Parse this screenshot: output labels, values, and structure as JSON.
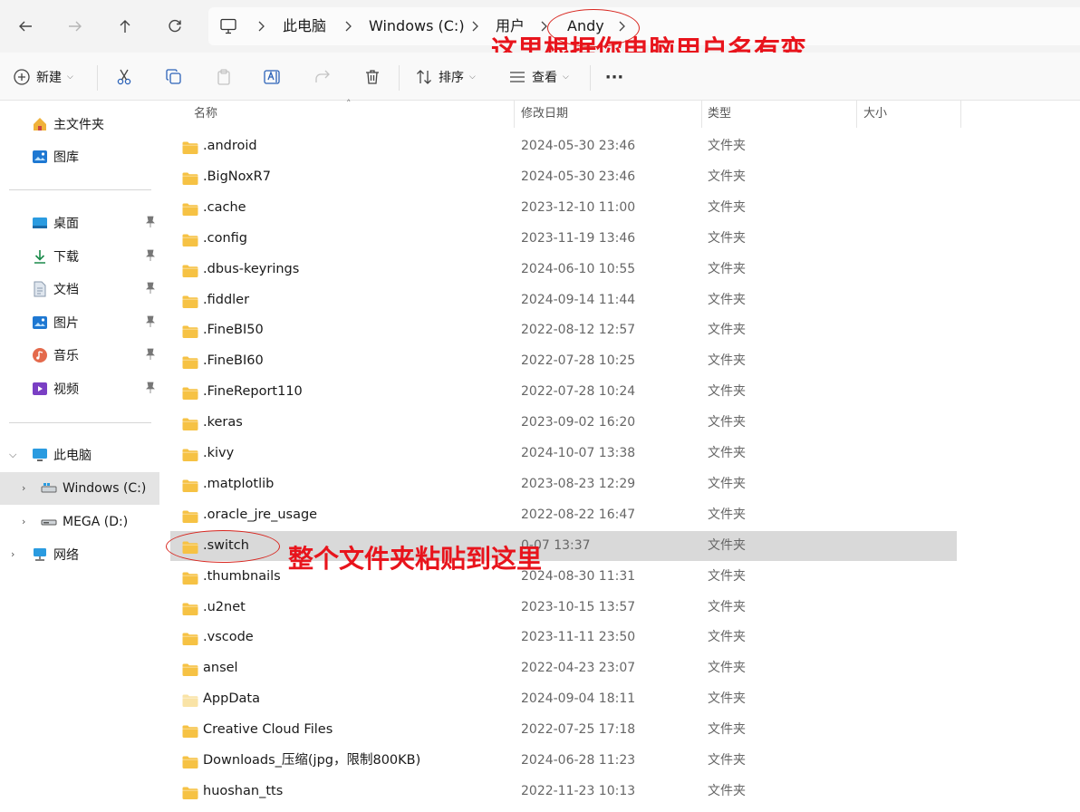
{
  "breadcrumb": {
    "items": [
      "此电脑",
      "Windows (C:)",
      "用户",
      "Andy"
    ]
  },
  "annotations": {
    "top": "这里根据你电脑用户名有变",
    "row": "整个文件夹粘贴到这里"
  },
  "toolbar": {
    "new_label": "新建",
    "sort_label": "排序",
    "view_label": "查看",
    "more_label": "···"
  },
  "sidebar": {
    "top_items": [
      {
        "label": "主文件夹",
        "icon": "home-icon"
      },
      {
        "label": "图库",
        "icon": "gallery-icon"
      }
    ],
    "quick_items": [
      {
        "label": "桌面",
        "icon": "desktop-icon"
      },
      {
        "label": "下载",
        "icon": "download-icon"
      },
      {
        "label": "文档",
        "icon": "document-icon"
      },
      {
        "label": "图片",
        "icon": "pictures-icon"
      },
      {
        "label": "音乐",
        "icon": "music-icon"
      },
      {
        "label": "视频",
        "icon": "video-icon"
      }
    ],
    "tree_items": [
      {
        "label": "此电脑",
        "icon": "pc-icon"
      },
      {
        "label": "Windows (C:)",
        "icon": "drive-icon"
      },
      {
        "label": "MEGA (D:)",
        "icon": "drive-icon"
      },
      {
        "label": "网络",
        "icon": "network-icon"
      }
    ]
  },
  "columns": {
    "name": "名称",
    "date": "修改日期",
    "type": "类型",
    "size": "大小"
  },
  "files": [
    {
      "name": ".android",
      "date": "2024-05-30 23:46",
      "type": "文件夹"
    },
    {
      "name": ".BigNoxR7",
      "date": "2024-05-30 23:46",
      "type": "文件夹"
    },
    {
      "name": ".cache",
      "date": "2023-12-10 11:00",
      "type": "文件夹"
    },
    {
      "name": ".config",
      "date": "2023-11-19 13:46",
      "type": "文件夹"
    },
    {
      "name": ".dbus-keyrings",
      "date": "2024-06-10 10:55",
      "type": "文件夹"
    },
    {
      "name": ".fiddler",
      "date": "2024-09-14 11:44",
      "type": "文件夹"
    },
    {
      "name": ".FineBI50",
      "date": "2022-08-12 12:57",
      "type": "文件夹"
    },
    {
      "name": ".FineBI60",
      "date": "2022-07-28 10:25",
      "type": "文件夹"
    },
    {
      "name": ".FineReport110",
      "date": "2022-07-28 10:24",
      "type": "文件夹"
    },
    {
      "name": ".keras",
      "date": "2023-09-02 16:20",
      "type": "文件夹"
    },
    {
      "name": ".kivy",
      "date": "2024-10-07 13:38",
      "type": "文件夹"
    },
    {
      "name": ".matplotlib",
      "date": "2023-08-23 12:29",
      "type": "文件夹"
    },
    {
      "name": ".oracle_jre_usage",
      "date": "2022-08-22 16:47",
      "type": "文件夹"
    },
    {
      "name": ".switch",
      "date": "0-07 13:37",
      "type": "文件夹",
      "selected": true
    },
    {
      "name": ".thumbnails",
      "date": "2024-08-30 11:31",
      "type": "文件夹"
    },
    {
      "name": ".u2net",
      "date": "2023-10-15 13:57",
      "type": "文件夹"
    },
    {
      "name": ".vscode",
      "date": "2023-11-11 23:50",
      "type": "文件夹"
    },
    {
      "name": "ansel",
      "date": "2022-04-23 23:07",
      "type": "文件夹"
    },
    {
      "name": "AppData",
      "date": "2024-09-04 18:11",
      "type": "文件夹",
      "hidden": true
    },
    {
      "name": "Creative Cloud Files",
      "date": "2022-07-25 17:18",
      "type": "文件夹"
    },
    {
      "name": "Downloads_压缩(jpg，限制800KB)",
      "date": "2024-06-28 11:23",
      "type": "文件夹"
    },
    {
      "name": "huoshan_tts",
      "date": "2022-11-23 10:13",
      "type": "文件夹"
    }
  ],
  "colors": {
    "folder": "#f6c244",
    "folder_hidden": "#f9e3a6",
    "annotation_red": "#e8141c",
    "selected_row": "#d9d9d9"
  }
}
